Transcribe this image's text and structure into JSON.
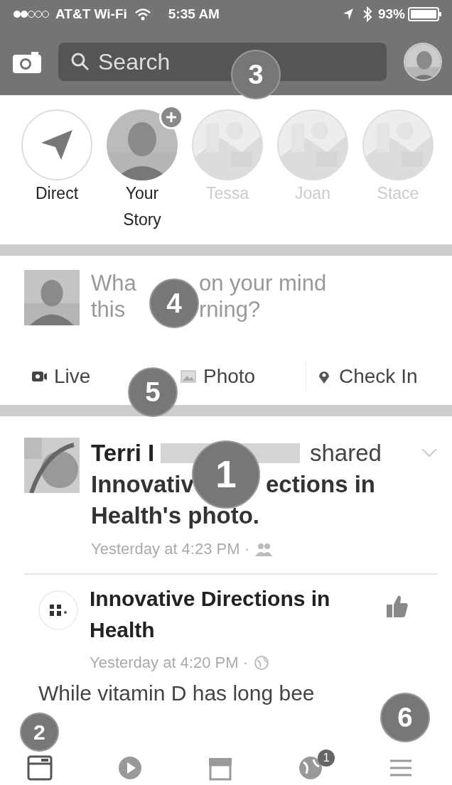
{
  "status_bar": {
    "carrier": "AT&T Wi-Fi",
    "time": "5:35 AM",
    "battery": "93%"
  },
  "nav_bar": {
    "search": {
      "placeholder": "Search"
    }
  },
  "stories": [
    {
      "kind": "direct",
      "label": "Direct"
    },
    {
      "kind": "own",
      "label": "Your Story"
    },
    {
      "kind": "friend",
      "label": "Tessa"
    },
    {
      "kind": "friend",
      "label": "Joan"
    },
    {
      "kind": "friend",
      "label": "Stace"
    }
  ],
  "composer": {
    "placeholder_lines": [
      [
        "Wha",
        "on your mind"
      ],
      [
        "this",
        "rning?"
      ]
    ]
  },
  "composer_actions": [
    {
      "kind": "live",
      "label": "Live"
    },
    {
      "label": "Photo"
    },
    {
      "kind": "checkin",
      "label": "Check In"
    }
  ],
  "post": {
    "headline_lines": [
      [
        {
          "kind": "text",
          "text": "Terri I",
          "bold": true
        },
        {
          "kind": "redacted"
        },
        {
          "kind": "text",
          "text": "shared",
          "bold": false
        }
      ],
      [
        {
          "kind": "text",
          "text": "Innovativ",
          "bold": true
        },
        {
          "kind": "text",
          "text": "ections in",
          "bold": true
        }
      ],
      [
        {
          "kind": "text",
          "text": "Health's photo.",
          "bold": true
        }
      ]
    ],
    "time": "Yesterday at 4:23 PM ·",
    "shared": {
      "page": "Innovative Directions in Health",
      "time": "Yesterday at 4:20 PM ·",
      "text": "While vitamin D has long bee"
    }
  },
  "tab_bar": [
    {
      "kind": "feed",
      "selected": true
    },
    {
      "kind": "video",
      "selected": false
    },
    {
      "kind": "market",
      "selected": false
    },
    {
      "kind": "notifications",
      "selected": false,
      "badge": "1"
    },
    {
      "kind": "menu",
      "selected": false
    }
  ],
  "callouts": [
    {
      "number": "1"
    },
    {
      "number": "2"
    },
    {
      "number": "3"
    },
    {
      "number": "4"
    },
    {
      "number": "5"
    },
    {
      "number": "6"
    }
  ]
}
